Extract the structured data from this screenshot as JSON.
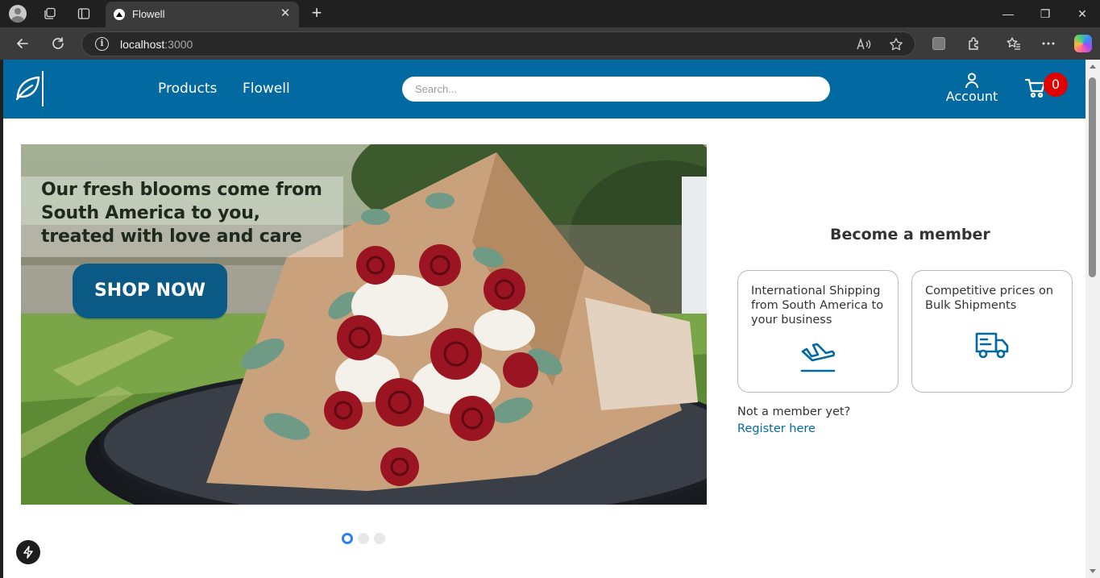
{
  "browser": {
    "tab_title": "Flowell",
    "tab_close": "✕",
    "new_tab": "+",
    "url_host": "localhost",
    "url_port": ":3000",
    "info_glyph": "i",
    "window_controls": {
      "minimize": "—",
      "restore": "❐",
      "close": "✕"
    },
    "icons": [
      "profile-icon",
      "collections-icon",
      "tab-actions-icon",
      "back-icon",
      "refresh-icon",
      "info-icon",
      "read-aloud-icon",
      "favorite-icon",
      "extension-square-icon",
      "extensions-icon",
      "favorites-icon",
      "more-icon",
      "copilot-icon"
    ]
  },
  "header": {
    "nav": [
      {
        "label": "Products"
      },
      {
        "label": "Flowell"
      }
    ],
    "search_placeholder": "Search...",
    "account_label": "Account",
    "cart_count": "0",
    "brand_color": "#0369a1"
  },
  "hero": {
    "headline_lines": [
      "Our fresh blooms come from",
      "South America to you,",
      "treated with love and care"
    ],
    "cta_label": "SHOP NOW",
    "carousel": {
      "slides": 3,
      "active_index": 0
    }
  },
  "member": {
    "title": "Become a member",
    "cards": [
      {
        "text": "International Shipping from South America to your business",
        "icon": "airplane-landing-icon"
      },
      {
        "text": "Competitive prices on Bulk Shipments",
        "icon": "delivery-truck-icon"
      }
    ],
    "not_member_text": "Not a member yet?",
    "register_link": "Register here"
  },
  "dev_tools": {
    "icon": "lightning-bolt-icon"
  }
}
